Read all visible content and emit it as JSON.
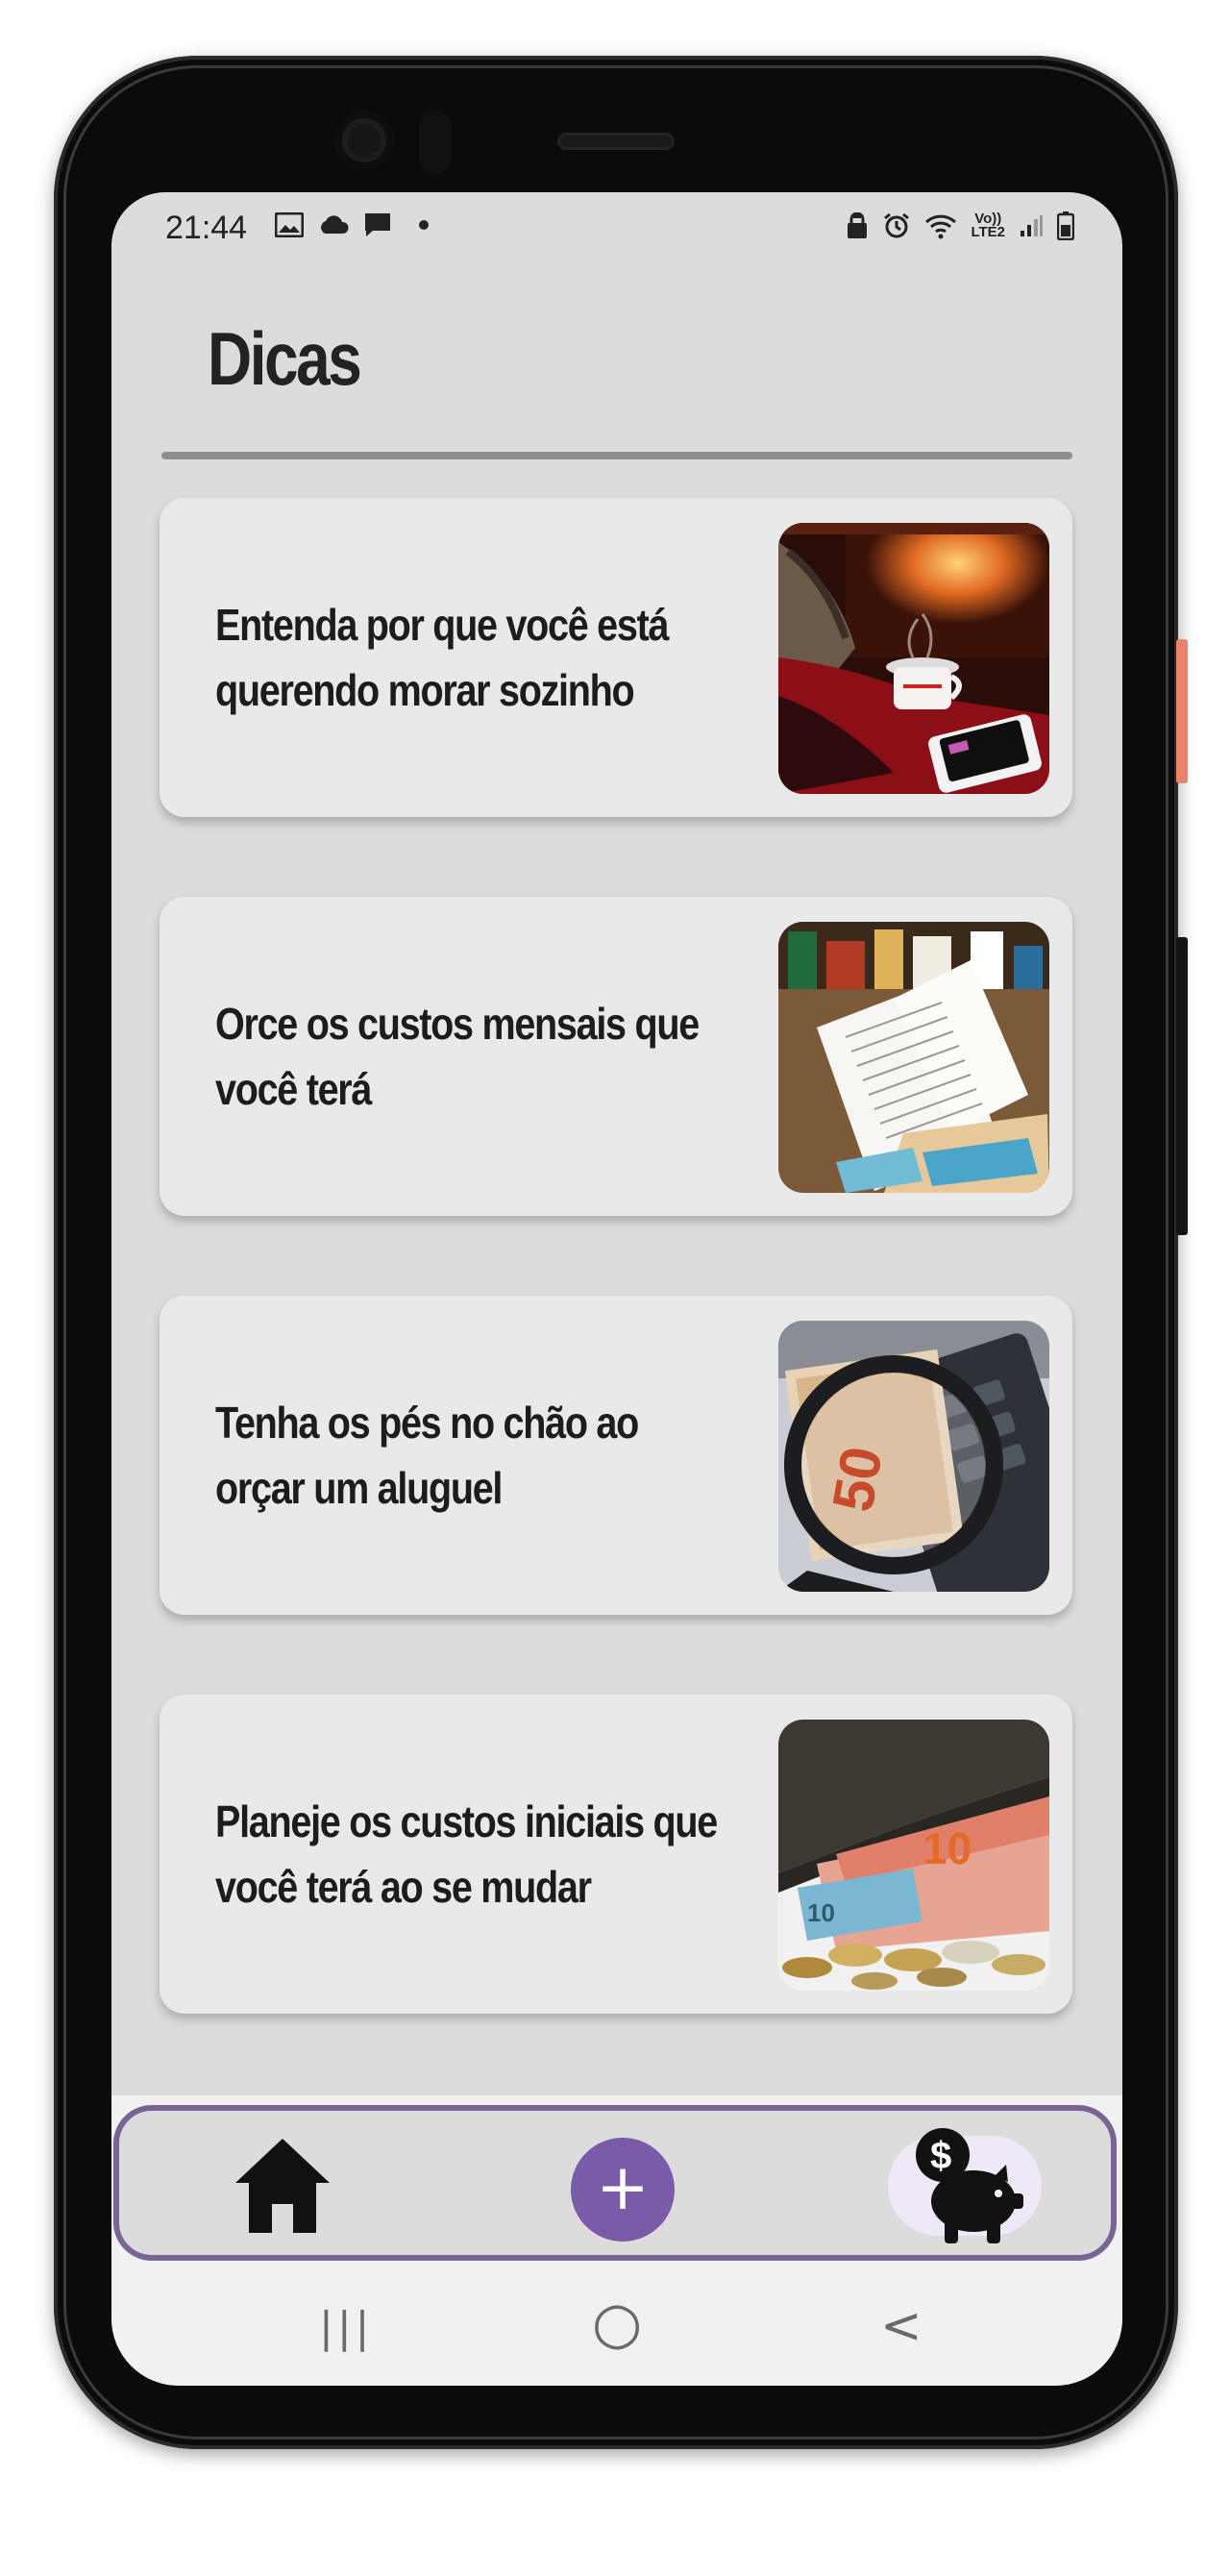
{
  "status_bar": {
    "time": "21:44",
    "left_icons": [
      "image-icon",
      "cloud-icon",
      "message-icon",
      "dot-icon"
    ],
    "right_icons": [
      "lock-icon",
      "alarm-icon",
      "wifi-icon",
      "volte-icon",
      "signal-icon",
      "battery-icon"
    ],
    "volte_text": "Vo))",
    "lte_text": "LTE2"
  },
  "page": {
    "title": "Dicas"
  },
  "tips": [
    {
      "title": "Entenda por que você está querendo morar sozinho",
      "image": "cozy-home-photo"
    },
    {
      "title": "Orce os custos mensais que você terá",
      "image": "receipts-photo"
    },
    {
      "title": "Tenha os pés no chão ao orçar um aluguel",
      "image": "magnifier-money-photo"
    },
    {
      "title": "Planeje os custos iniciais que você terá ao se mudar",
      "image": "wallet-coins-photo"
    }
  ],
  "bottom_nav": {
    "items": [
      {
        "name": "home",
        "icon": "home-icon"
      },
      {
        "name": "add",
        "icon": "plus-icon",
        "label": "+"
      },
      {
        "name": "savings",
        "icon": "piggy-bank-icon"
      }
    ],
    "accent_color": "#7a5ba8",
    "border_color": "#7a6496"
  },
  "system_nav": {
    "recents": "|||",
    "home": "○",
    "back": "<"
  }
}
